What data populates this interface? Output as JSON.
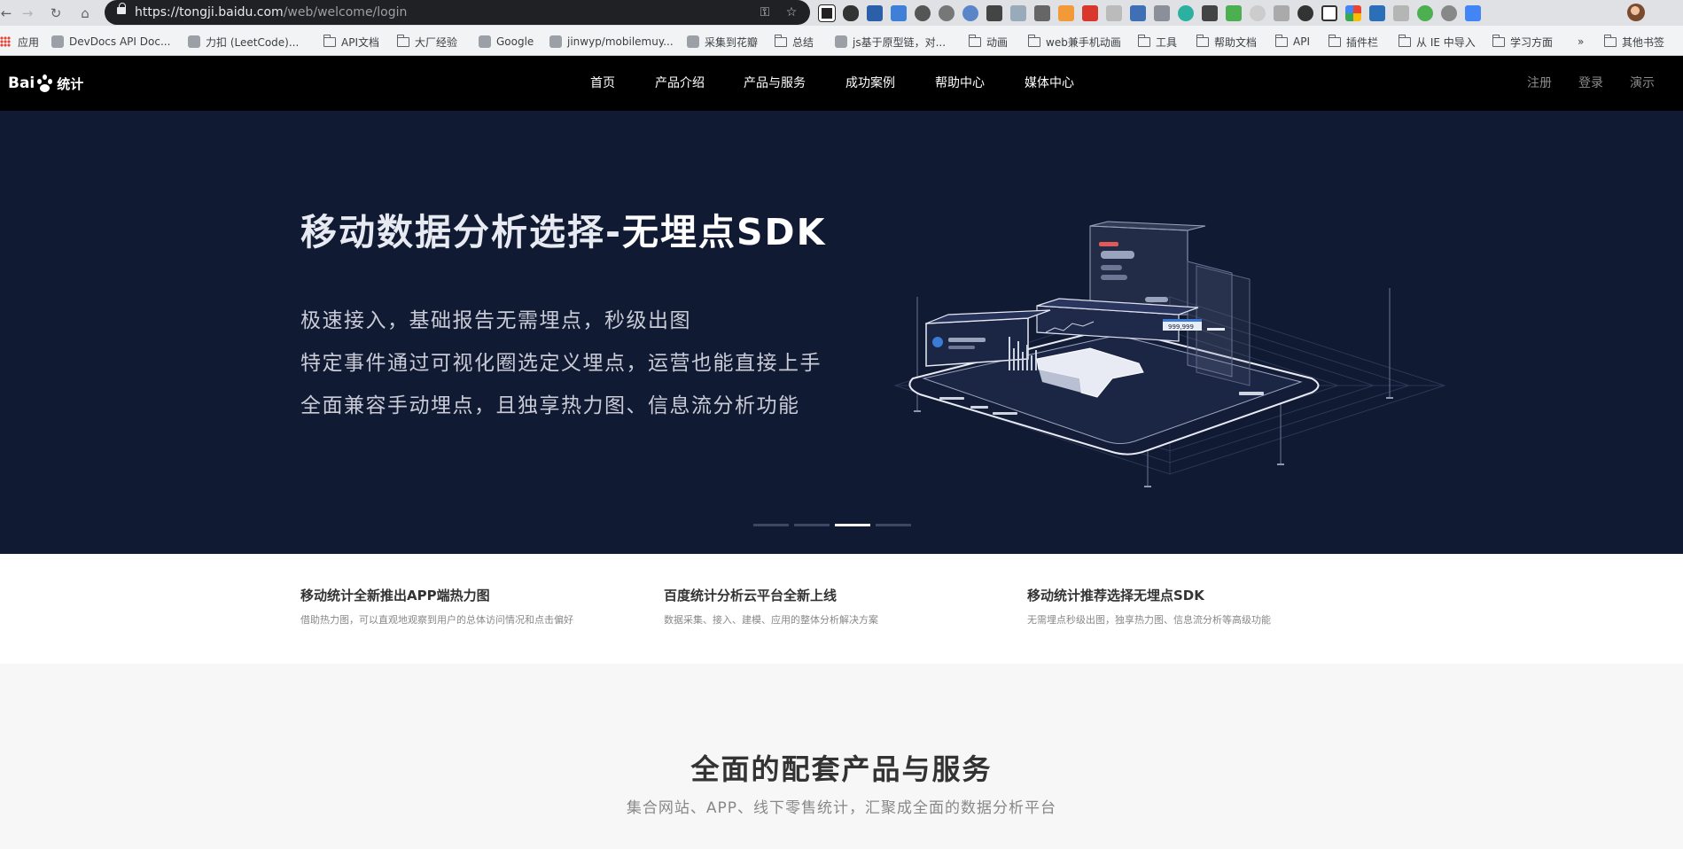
{
  "browser": {
    "url_host": "https://tongji.baidu.com",
    "url_path": "/web/welcome/login",
    "bookmarks": [
      {
        "label": "应用",
        "type": "apps"
      },
      {
        "label": "DevDocs API Doc...",
        "type": "site"
      },
      {
        "label": "力扣 (LeetCode)...",
        "type": "site"
      },
      {
        "label": "API文档",
        "type": "folder"
      },
      {
        "label": "大厂经验",
        "type": "folder"
      },
      {
        "label": "Google",
        "type": "site"
      },
      {
        "label": "jinwyp/mobilemuy...",
        "type": "site"
      },
      {
        "label": "采集到花瓣",
        "type": "site"
      },
      {
        "label": "总结",
        "type": "folder"
      },
      {
        "label": "js基于原型链，对...",
        "type": "site"
      },
      {
        "label": "动画",
        "type": "folder"
      },
      {
        "label": "web兼手机动画",
        "type": "folder"
      },
      {
        "label": "工具",
        "type": "folder"
      },
      {
        "label": "帮助文档",
        "type": "folder"
      },
      {
        "label": "API",
        "type": "folder"
      },
      {
        "label": "插件栏",
        "type": "folder"
      },
      {
        "label": "从 IE 中导入",
        "type": "folder"
      },
      {
        "label": "学习方面",
        "type": "folder"
      },
      {
        "label": "»",
        "type": "more"
      },
      {
        "label": "其他书签",
        "type": "folder"
      }
    ]
  },
  "header": {
    "logo_text_en": "Bai",
    "logo_text_cn": "统计",
    "nav": [
      "首页",
      "产品介绍",
      "产品与服务",
      "成功案例",
      "帮助中心",
      "媒体中心"
    ],
    "user_links": [
      "注册",
      "登录",
      "演示"
    ]
  },
  "hero": {
    "title_plain": "移动数据分析选择-",
    "title_bold": "无埋点SDK",
    "lines": [
      "极速接入，基础报告无需埋点，秒级出图",
      "特定事件通过可视化圈选定义埋点，运营也能直接上手",
      "全面兼容手动埋点，且独享热力图、信息流分析功能"
    ],
    "art_number": "999,999",
    "carousel": {
      "count": 4,
      "active": 3
    }
  },
  "news": [
    {
      "title": "移动统计全新推出APP端热力图",
      "desc": "借助热力图，可以直观地观察到用户的总体访问情况和点击偏好"
    },
    {
      "title": "百度统计分析云平台全新上线",
      "desc": "数据采集、接入、建模、应用的整体分析解决方案"
    },
    {
      "title": "移动统计推荐选择无埋点SDK",
      "desc": "无需埋点秒级出图，独享热力图、信息流分析等高级功能"
    }
  ],
  "section": {
    "title": "全面的配套产品与服务",
    "subtitle": "集合网站、APP、线下零售统计，汇聚成全面的数据分析平台"
  }
}
